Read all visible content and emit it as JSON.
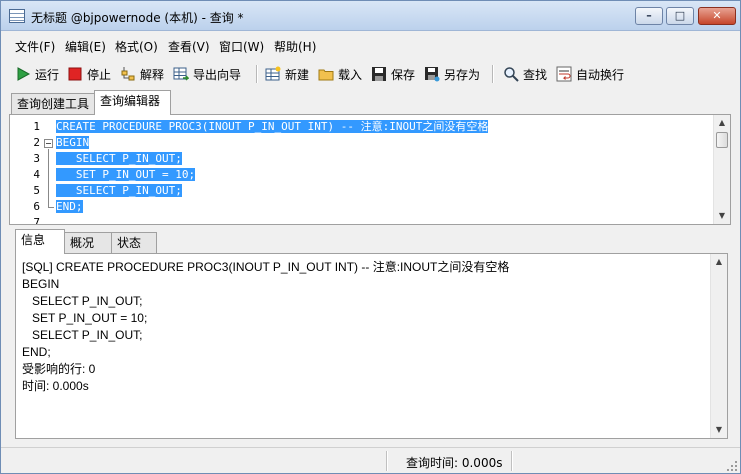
{
  "window": {
    "title": "无标题 @bjpowernode (本机) - 查询 *",
    "min_glyph": "–",
    "max_glyph": "□",
    "close_glyph": "✕"
  },
  "menu": [
    "文件(F)",
    "编辑(E)",
    "格式(O)",
    "查看(V)",
    "窗口(W)",
    "帮助(H)"
  ],
  "toolbar": {
    "run": "运行",
    "stop": "停止",
    "explain": "解释",
    "export_wizard": "导出向导",
    "new": "新建",
    "load": "载入",
    "save": "保存",
    "save_as": "另存为",
    "find": "查找",
    "word_wrap": "自动换行"
  },
  "top_tabs": [
    "查询创建工具",
    "查询编辑器"
  ],
  "editor": {
    "line_numbers": [
      "1",
      "2",
      "3",
      "4",
      "5",
      "6",
      "7"
    ],
    "lines": [
      "CREATE PROCEDURE PROC3(INOUT P_IN_OUT INT) -- 注意:INOUT之间没有空格",
      "BEGIN",
      "   SELECT P_IN_OUT;",
      "   SET P_IN_OUT = 10;",
      "   SELECT P_IN_OUT;",
      "END;",
      ""
    ]
  },
  "bottom_tabs": [
    "信息",
    "概况",
    "状态"
  ],
  "output": {
    "lines": [
      "[SQL] CREATE PROCEDURE PROC3(INOUT P_IN_OUT INT) -- 注意:INOUT之间没有空格",
      "BEGIN",
      "   SELECT P_IN_OUT;",
      "   SET P_IN_OUT = 10;",
      "   SELECT P_IN_OUT;",
      "END;",
      "受影响的行: 0",
      "时间: 0.000s"
    ]
  },
  "status": {
    "query_time": "查询时间: 0.000s"
  },
  "colors": {
    "selection": "#3399ff",
    "title_gradient_top": "#d9e6f6",
    "close_button": "#c6462b"
  }
}
